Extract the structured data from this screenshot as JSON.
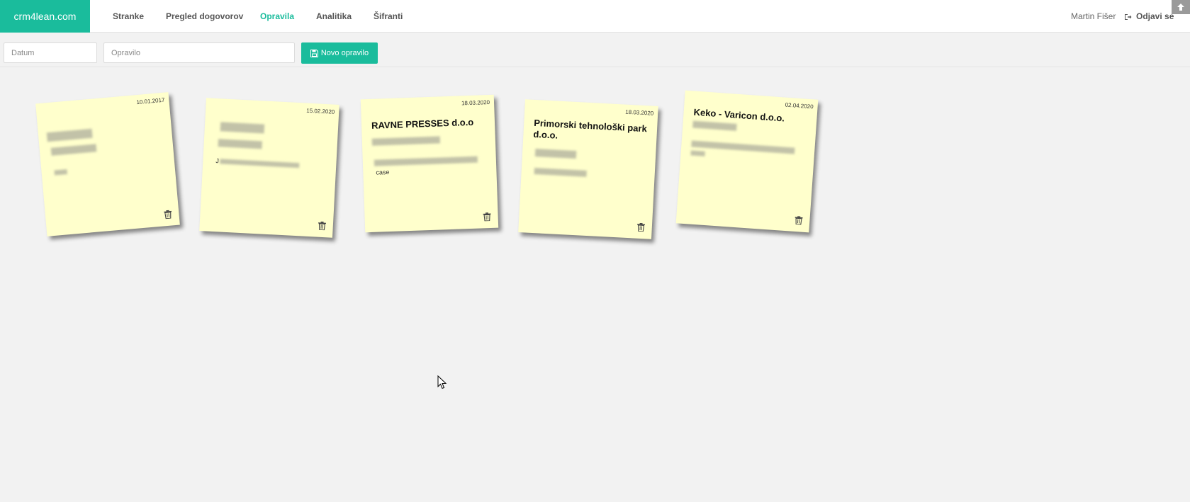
{
  "navbar": {
    "brand": "crm4lean.com",
    "items": [
      {
        "label": "Stranke",
        "active": false
      },
      {
        "label": "Pregled dogovorov",
        "active": false
      },
      {
        "label": "Opravila",
        "active": true
      },
      {
        "label": "Analitika",
        "active": false
      },
      {
        "label": "Šifranti",
        "active": false
      }
    ],
    "user": "Martin Fišer",
    "logout_label": "Odjavi se",
    "logout_icon": "sign-out-icon",
    "scroll_top_icon": "arrow-up-icon"
  },
  "filters": {
    "date_placeholder": "Datum",
    "task_placeholder": "Opravilo",
    "new_button_label": "Novo opravilo",
    "new_button_icon": "save-icon"
  },
  "notes": [
    {
      "date": "10.01.2017",
      "title": "",
      "extra_text": ""
    },
    {
      "date": "15.02.2020",
      "title": "",
      "extra_text": "J"
    },
    {
      "date": "18.03.2020",
      "title": "RAVNE PRESSES d.o.o",
      "extra_text": "case"
    },
    {
      "date": "18.03.2020",
      "title": "Primorski tehnološki park d.o.o.",
      "extra_text": ""
    },
    {
      "date": "02.04.2020",
      "title": "Keko - Varicon d.o.o.",
      "extra_text": ""
    }
  ],
  "colors": {
    "accent": "#1abc9c",
    "note_background": "#ffffcc",
    "page_background": "#f2f2f2"
  }
}
